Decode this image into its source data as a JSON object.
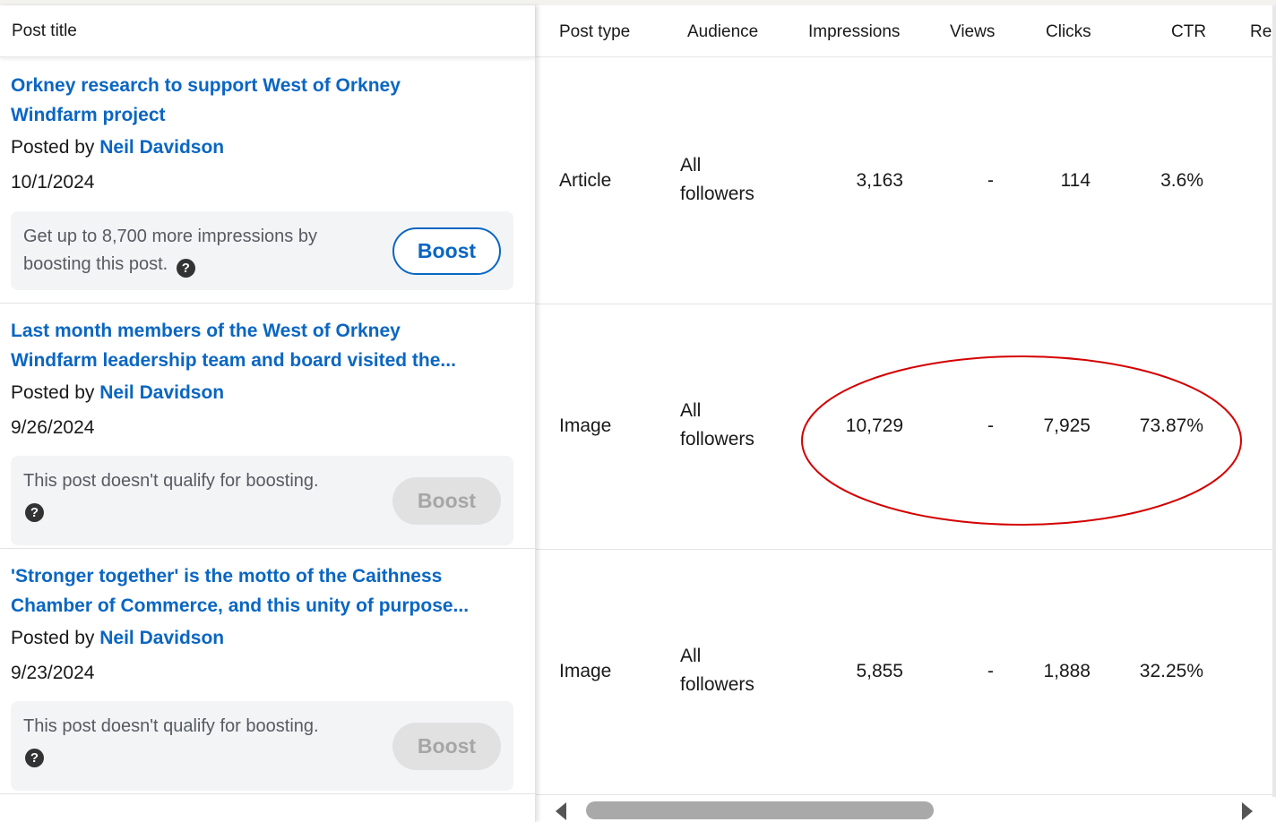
{
  "columns": {
    "post_title": "Post title",
    "post_type": "Post type",
    "audience": "Audience",
    "impressions": "Impressions",
    "views": "Views",
    "clicks": "Clicks",
    "ctr": "CTR",
    "next_partial": "Re"
  },
  "rows": [
    {
      "title_line1": "Orkney research to support West of Orkney",
      "title_line2": "Windfarm project",
      "posted_by_prefix": "Posted by",
      "author": "Neil Davidson",
      "date": "10/1/2024",
      "boost_text": "Get up to 8,700 more impressions by boosting this post.",
      "boost_label": "Boost",
      "boost_enabled": true,
      "post_type": "Article",
      "audience_line1": "All",
      "audience_line2": "followers",
      "impressions": "3,163",
      "views": "-",
      "clicks": "114",
      "ctr": "3.6%"
    },
    {
      "title_line1": "Last month members of the West of Orkney",
      "title_line2": "Windfarm leadership team and board visited the...",
      "posted_by_prefix": "Posted by",
      "author": "Neil Davidson",
      "date": "9/26/2024",
      "boost_text": "This post doesn't qualify for boosting.",
      "boost_label": "Boost",
      "boost_enabled": false,
      "post_type": "Image",
      "audience_line1": "All",
      "audience_line2": "followers",
      "impressions": "10,729",
      "views": "-",
      "clicks": "7,925",
      "ctr": "73.87%"
    },
    {
      "title_line1": "'Stronger together' is the motto of the Caithness",
      "title_line2": "Chamber of Commerce, and this unity of purpose...",
      "posted_by_prefix": "Posted by",
      "author": "Neil Davidson",
      "date": "9/23/2024",
      "boost_text": "This post doesn't qualify for boosting.",
      "boost_label": "Boost",
      "boost_enabled": false,
      "post_type": "Image",
      "audience_line1": "All",
      "audience_line2": "followers",
      "impressions": "5,855",
      "views": "-",
      "clicks": "1,888",
      "ctr": "32.25%"
    }
  ],
  "icons": {
    "help": "question-circle-icon",
    "scroll_left": "caret-left-icon",
    "scroll_right": "caret-right-icon"
  },
  "colors": {
    "link": "#0a66c2",
    "annotation": "#d40000",
    "disabled_button": "#e1e1e1"
  },
  "annotation": {
    "shape": "ellipse",
    "color": "#d40000",
    "highlights_row": 2
  }
}
